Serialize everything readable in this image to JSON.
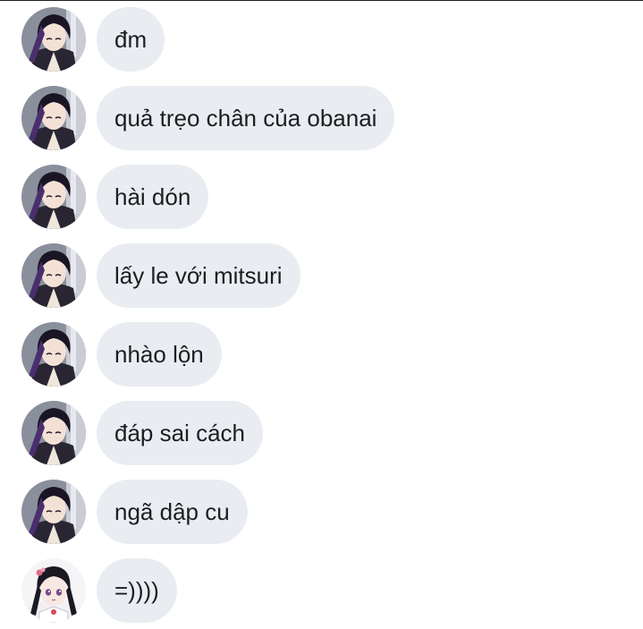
{
  "messages": [
    {
      "avatar": "shinobu-avatar",
      "text": "đm"
    },
    {
      "avatar": "shinobu-avatar",
      "text": "quả trẹo chân của obanai"
    },
    {
      "avatar": "shinobu-avatar",
      "text": "hài dón"
    },
    {
      "avatar": "shinobu-avatar",
      "text": "lấy le với mitsuri"
    },
    {
      "avatar": "shinobu-avatar",
      "text": "nhào lộn"
    },
    {
      "avatar": "shinobu-avatar",
      "text": "đáp sai cách"
    },
    {
      "avatar": "shinobu-avatar",
      "text": "ngã dập cu"
    },
    {
      "avatar": "kanao-avatar",
      "text": "=))))"
    }
  ],
  "colors": {
    "bubble": "#e9edf1",
    "text": "#1c1e21"
  }
}
